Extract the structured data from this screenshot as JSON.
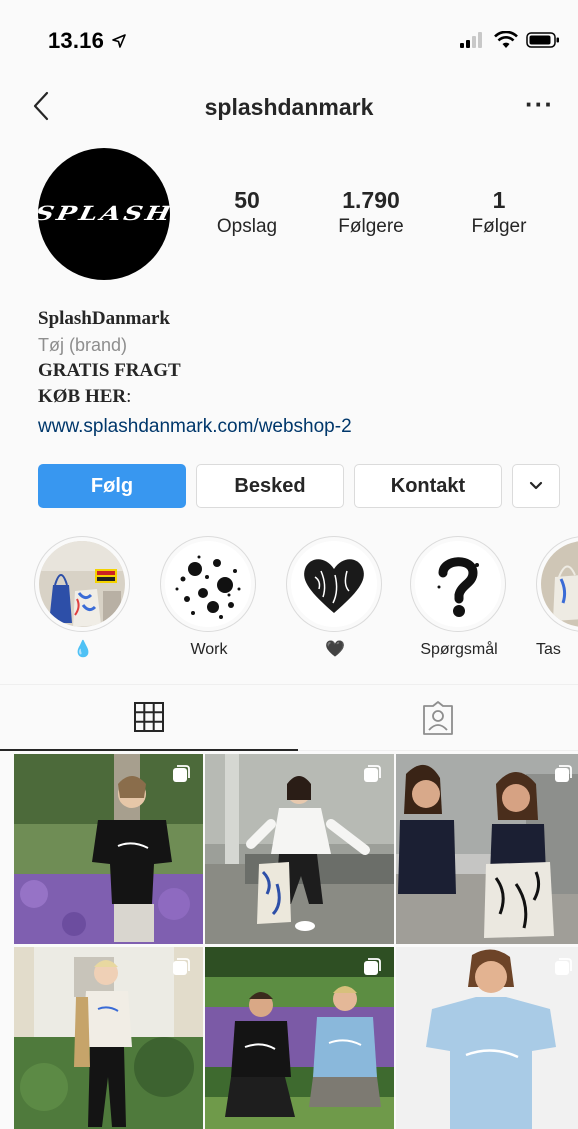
{
  "status_bar": {
    "time": "13.16"
  },
  "nav": {
    "title": "splashdanmark",
    "more": "···"
  },
  "profile": {
    "avatar_text": "SPLASH",
    "stats": [
      {
        "value": "50",
        "label": "Opslag"
      },
      {
        "value": "1.790",
        "label": "Følgere"
      },
      {
        "value": "1",
        "label": "Følger"
      }
    ],
    "bio": {
      "name": "SplashDanmark",
      "category": "Tøj (brand)",
      "line1": "GRATIS FRAGT",
      "line2_bold": "KØB HER",
      "line2_rest": ":",
      "link": "www.splashdanmark.com/webshop-2"
    }
  },
  "actions": {
    "follow": "Følg",
    "message": "Besked",
    "contact": "Kontakt"
  },
  "highlights": [
    {
      "label": "💧"
    },
    {
      "label": "Work"
    },
    {
      "label": "🖤"
    },
    {
      "label": "Spørgsmål"
    },
    {
      "label": "Tas"
    }
  ],
  "colors": {
    "accent": "#3897f0",
    "link": "#00376b",
    "muted": "#8e8e8e"
  }
}
